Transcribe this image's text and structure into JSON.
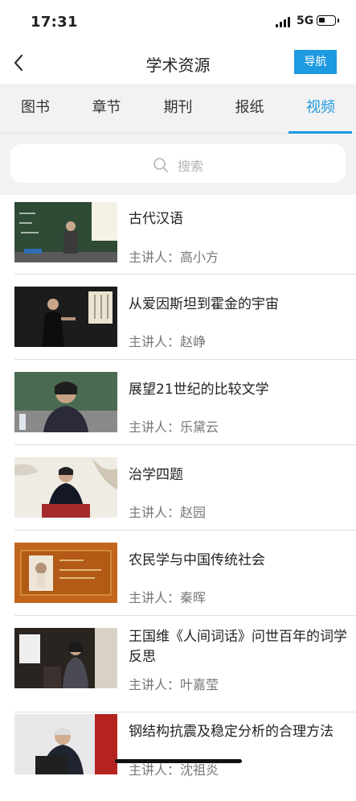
{
  "status": {
    "time": "17:31",
    "network": "5G"
  },
  "nav": {
    "title": "学术资源",
    "nav_button": "导航"
  },
  "tabs": [
    {
      "label": "图书"
    },
    {
      "label": "章节"
    },
    {
      "label": "期刊"
    },
    {
      "label": "报纸"
    },
    {
      "label": "视频",
      "active": true
    }
  ],
  "search": {
    "placeholder": "搜索"
  },
  "videos": [
    {
      "title": "古代汉语",
      "speaker": "主讲人：高小方"
    },
    {
      "title": "从爱因斯坦到霍金的宇宙",
      "speaker": "主讲人：赵峥"
    },
    {
      "title": "展望21世纪的比较文学",
      "speaker": "主讲人：乐黛云"
    },
    {
      "title": "治学四题",
      "speaker": "主讲人：赵园"
    },
    {
      "title": "农民学与中国传统社会",
      "speaker": "主讲人：秦晖"
    },
    {
      "title": "王国维《人间词话》问世百年的词学反思",
      "speaker": "主讲人：叶嘉莹"
    },
    {
      "title": "钢结构抗震及稳定分析的合理方法",
      "speaker": "主讲人：沈祖炎"
    }
  ]
}
